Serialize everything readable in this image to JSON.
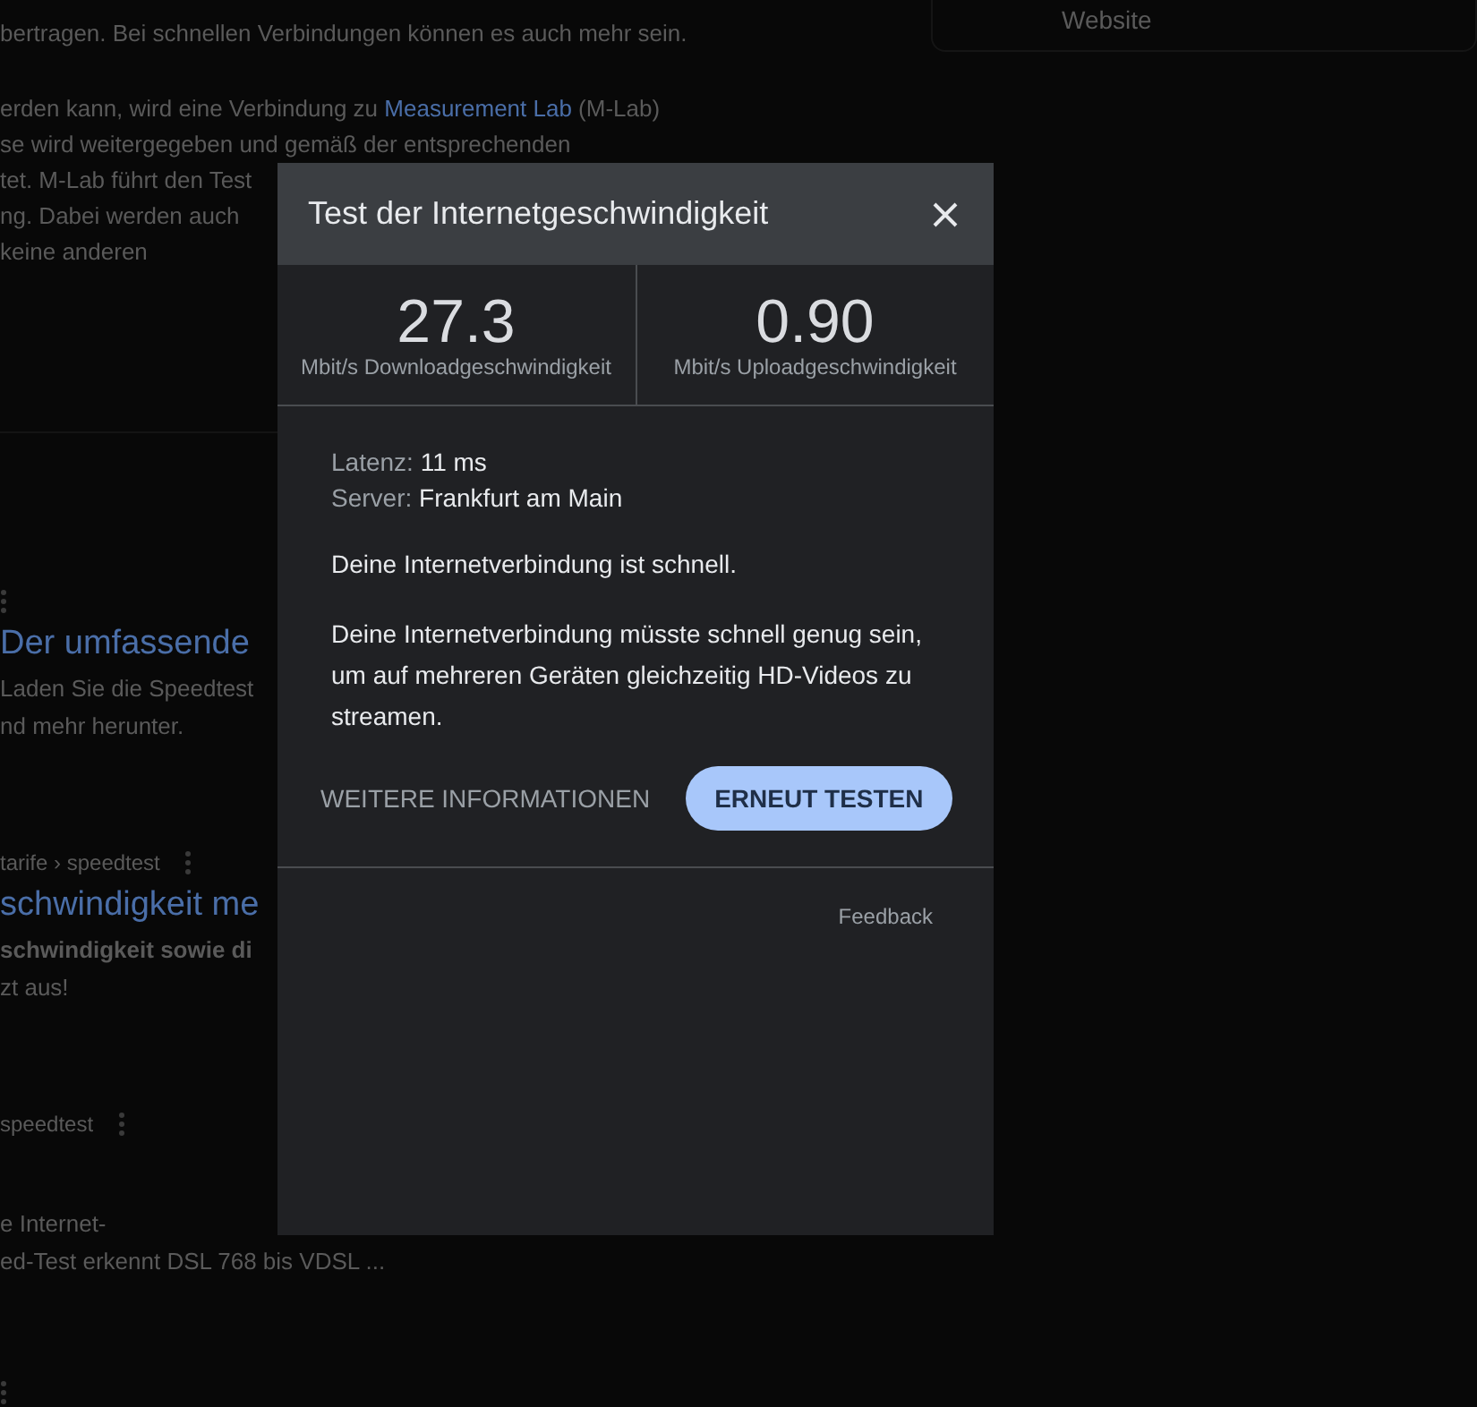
{
  "background": {
    "intro_lines": [
      "bertragen. Bei schnellen Verbindungen können es auch mehr sein."
    ],
    "mlab_line": {
      "before": "erden kann, wird eine Verbindung zu ",
      "link": "Measurement Lab",
      "after": " (M-Lab)"
    },
    "more_lines": [
      "se wird weitergegeben und gemäß der entsprechenden",
      "tet. M-Lab führt den Test",
      "ng. Dabei werden auch",
      "keine anderen"
    ],
    "results": [
      {
        "title": "Der umfassende",
        "snippet": [
          {
            "text": "Laden Sie die Speedtest",
            "bold": false
          },
          {
            "text": "nd mehr herunter.",
            "bold": false
          }
        ]
      },
      {
        "breadcrumb": "tarife › speedtest",
        "title": "schwindigkeit me",
        "snippet": [
          {
            "text": "schwindigkeit sowie di",
            "bold": true
          },
          {
            "text": "zt aus!",
            "bold": false
          }
        ]
      },
      {
        "breadcrumb": "speedtest",
        "snippet": [
          {
            "text": "e Internet-",
            "bold": false
          },
          {
            "text": "ed-Test erkennt DSL 768 bis VDSL ...",
            "bold": false
          }
        ]
      }
    ],
    "side_card": {
      "label": "Website"
    }
  },
  "dialog": {
    "title": "Test der Internetgeschwindigkeit",
    "results": [
      {
        "value": "27.3",
        "label": "Mbit/s Downloadgeschwindigkeit"
      },
      {
        "value": "0.90",
        "label": "Mbit/s Uploadgeschwindigkeit"
      }
    ],
    "details": [
      {
        "label": "Latenz:",
        "value": "11 ms"
      },
      {
        "label": "Server:",
        "value": "Frankfurt am Main"
      }
    ],
    "message": "Deine Internetverbindung ist schnell.",
    "explanation": "Deine Internetverbindung müsste schnell genug sein, um auf mehreren Geräten gleichzeitig HD-Videos zu streamen.",
    "more_button": "WEITERE INFORMATIONEN",
    "retest_button": "ERNEUT TESTEN",
    "feedback": "Feedback"
  }
}
